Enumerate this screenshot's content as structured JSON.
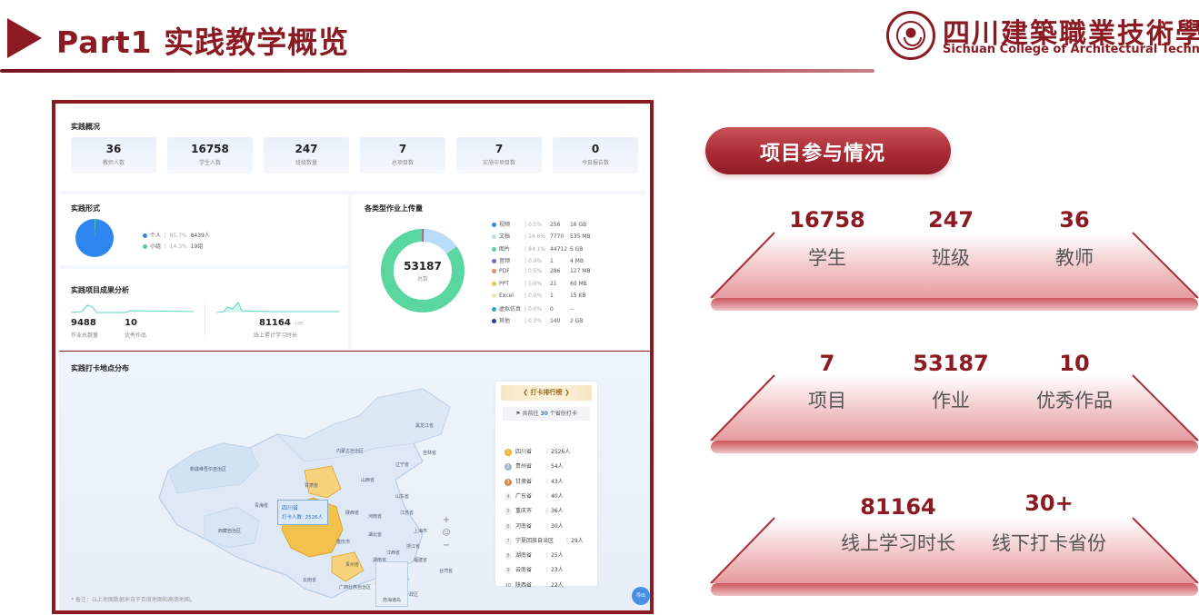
{
  "header": {
    "title": "Part1  实践教学概览",
    "logo_cn": "四川建築職業技術學院",
    "logo_en": "Sichuan College of Architectural Technology"
  },
  "dashboard": {
    "overview": {
      "title": "实践概况",
      "kpis": [
        {
          "value": "36",
          "label": "教师人数"
        },
        {
          "value": "16758",
          "label": "学生人数"
        },
        {
          "value": "247",
          "label": "班级数量"
        },
        {
          "value": "7",
          "label": "总项目数"
        },
        {
          "value": "7",
          "label": "实施中项目数"
        },
        {
          "value": "0",
          "label": "今日报告数"
        }
      ]
    },
    "form": {
      "title": "实践形式",
      "legend": [
        {
          "name": "个人",
          "pct": "85.7%",
          "count": "8439人",
          "color": "#2f86f0"
        },
        {
          "name": "小组",
          "pct": "14.3%",
          "count": "19组",
          "color": "#4fd1a5"
        }
      ]
    },
    "results": {
      "title": "实践项目成果分析",
      "homework_total": "9488",
      "homework_total_label": "作业总数量",
      "excellent": "10",
      "excellent_label": "优秀作品",
      "online_hours": "81164",
      "online_hours_unit": "小时",
      "online_hours_label": "线上累计学习时长"
    },
    "uploads": {
      "title": "各类型作业上传量",
      "total": "53187",
      "total_label": "总数",
      "types": [
        {
          "name": "视频",
          "pct": "0.5%",
          "count": "256",
          "size": "16 GB",
          "color": "#2f86f0",
          "share": 0.5
        },
        {
          "name": "文档",
          "pct": "14.6%",
          "count": "7770",
          "size": "535 MB",
          "color": "#b9dcf8",
          "share": 14.6
        },
        {
          "name": "图片",
          "pct": "84.1%",
          "count": "44712",
          "size": "5 GB",
          "color": "#5ad7a0",
          "share": 84.1
        },
        {
          "name": "音频",
          "pct": "0.0%",
          "count": "1",
          "size": "4 MB",
          "color": "#6b6bd6",
          "share": 0.0
        },
        {
          "name": "PDF",
          "pct": "0.5%",
          "count": "286",
          "size": "127 MB",
          "color": "#f08a5d",
          "share": 0.5
        },
        {
          "name": "PPT",
          "pct": "0.0%",
          "count": "21",
          "size": "60 MB",
          "color": "#f5c342",
          "share": 0.0
        },
        {
          "name": "Excel",
          "pct": "0.0%",
          "count": "1",
          "size": "15 KB",
          "color": "#f7e29c",
          "share": 0.0
        },
        {
          "name": "虚拟仿真",
          "pct": "0.0%",
          "count": "0",
          "size": "--",
          "color": "#2aa7c9",
          "share": 0.0
        },
        {
          "name": "其他",
          "pct": "0.3%",
          "count": "140",
          "size": "2 GB",
          "color": "#2b3aa8",
          "share": 0.3
        }
      ]
    },
    "map": {
      "title": "实践打卡地点分布",
      "tooltip_province": "四川省",
      "tooltip_value": "打卡人数: 2526人",
      "note": "* 备注：以上地图数据来自于百度地图和高德地图。",
      "south_sea": "南海诸岛",
      "export": "导出",
      "rank_title": "打卡排行榜",
      "rank_summary_pre": "共前往",
      "rank_summary_num": "30",
      "rank_summary_post": "个省份打卡",
      "ranking": [
        {
          "rank": "1",
          "province": "四川省",
          "count": "2526人"
        },
        {
          "rank": "2",
          "province": "贵州省",
          "count": "54人"
        },
        {
          "rank": "3",
          "province": "甘肃省",
          "count": "43人"
        },
        {
          "rank": "4",
          "province": "广东省",
          "count": "40人"
        },
        {
          "rank": "5",
          "province": "重庆市",
          "count": "36人"
        },
        {
          "rank": "6",
          "province": "河南省",
          "count": "30人"
        },
        {
          "rank": "7",
          "province": "宁夏回族自治区",
          "count": "29人"
        },
        {
          "rank": "8",
          "province": "湖南省",
          "count": "25人"
        },
        {
          "rank": "9",
          "province": "云南省",
          "count": "23人"
        },
        {
          "rank": "10",
          "province": "陕西省",
          "count": "22人"
        }
      ],
      "places": [
        "黑龙江省",
        "吉林省",
        "内蒙古自治区",
        "辽宁省",
        "新疆维吾尔自治区",
        "甘肃省",
        "山西省",
        "山东省",
        "青海省",
        "陕西省",
        "河南省",
        "江苏省",
        "西藏自治区",
        "四川省",
        "湖北省",
        "上海市",
        "重庆市",
        "浙江省",
        "贵州省",
        "湖南省",
        "江西省",
        "福建省",
        "云南省",
        "广西壮族自治区",
        "广东省",
        "台湾省",
        "香港特别行政区",
        "海南省"
      ]
    }
  },
  "participation": {
    "title": "项目参与情况",
    "rows": [
      [
        {
          "value": "16758",
          "label": "学生"
        },
        {
          "value": "247",
          "label": "班级"
        },
        {
          "value": "36",
          "label": "教师"
        }
      ],
      [
        {
          "value": "7",
          "label": "项目"
        },
        {
          "value": "53187",
          "label": "作业"
        },
        {
          "value": "10",
          "label": "优秀作品"
        }
      ],
      [
        {
          "value": "81164",
          "label": "线上学习时长"
        },
        {
          "value": "30+",
          "label": "线下打卡省份"
        }
      ]
    ]
  }
}
